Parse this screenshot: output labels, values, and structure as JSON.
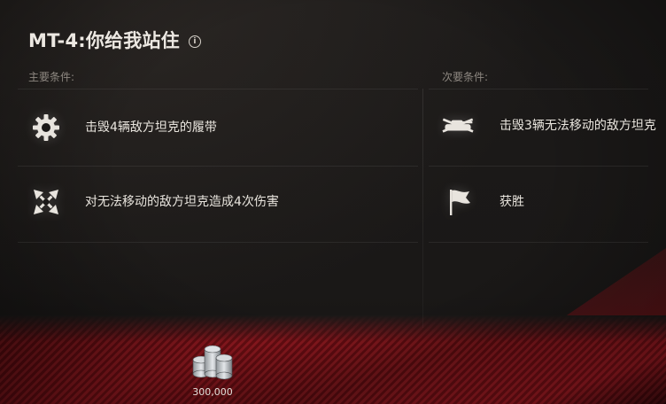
{
  "title": "MT-4:你给我站住",
  "info_icon": "info-icon",
  "primary": {
    "label": "主要条件:",
    "conditions": [
      {
        "icon": "gear-icon",
        "text": "击毁4辆敌方坦克的履带"
      },
      {
        "icon": "crossed-arrows-icon",
        "text": "对无法移动的敌方坦克造成4次伤害"
      }
    ]
  },
  "secondary": {
    "label": "次要条件:",
    "conditions": [
      {
        "icon": "immobilized-tank-icon",
        "text": "击毁3辆无法移动的敌方坦克"
      },
      {
        "icon": "flag-icon",
        "text": "获胜"
      }
    ]
  },
  "reward": {
    "icon": "silver-coins-icon",
    "amount": "300,000"
  },
  "colors": {
    "background": "#1a1817",
    "accent_red": "#8c1118",
    "text": "#e9e5de",
    "muted": "#8d8780"
  }
}
